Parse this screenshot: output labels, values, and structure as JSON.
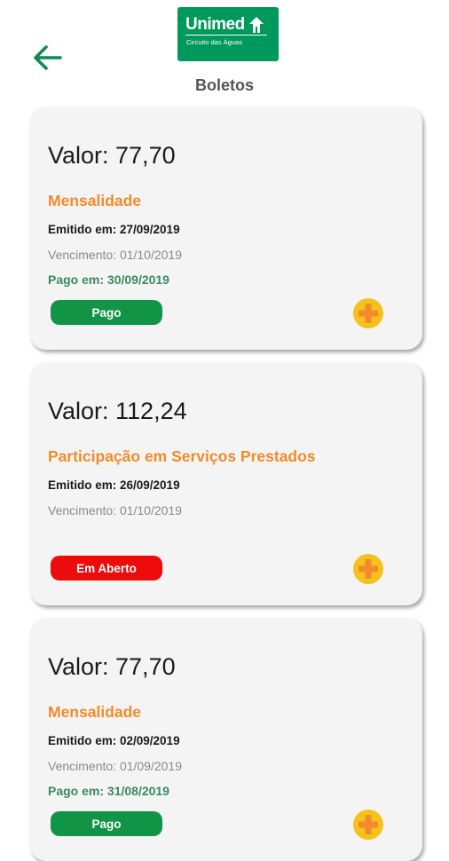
{
  "header": {
    "logo_name": "Unimed",
    "logo_subtitle": "Circuito das Águas",
    "title": "Boletos"
  },
  "colors": {
    "brand_green": "#00995c",
    "accent_orange": "#f28b2a",
    "paid_green": "#129447",
    "open_red": "#ee0b0b",
    "plus_yellow": "#f5c21b"
  },
  "boletos": [
    {
      "value_text": "Valor: 77,70",
      "type": "Mensalidade",
      "issued": "Emitido em: 27/09/2019",
      "due": "Vencimento: 01/10/2019",
      "paid": "Pago em: 30/09/2019",
      "status": "Pago",
      "status_color": "#129447"
    },
    {
      "value_text": "Valor: 112,24",
      "type": "Participação em Serviços Prestados",
      "issued": "Emitido em: 26/09/2019",
      "due": "Vencimento: 01/10/2019",
      "paid": "",
      "status": "Em Aberto",
      "status_color": "#ee0b0b"
    },
    {
      "value_text": "Valor: 77,70",
      "type": "Mensalidade",
      "issued": "Emitido em: 02/09/2019",
      "due": "Vencimento: 01/09/2019",
      "paid": "Pago em: 31/08/2019",
      "status": "Pago",
      "status_color": "#129447"
    }
  ]
}
